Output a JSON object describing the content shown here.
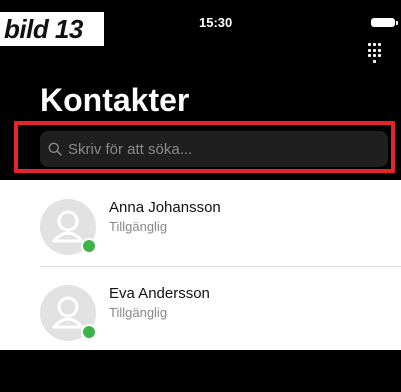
{
  "caption": "bild 13",
  "status_bar": {
    "time": "15:30",
    "battery_icon": "battery-icon"
  },
  "header": {
    "title": "Kontakter",
    "keypad_icon": "keypad-grid-icon"
  },
  "search": {
    "placeholder": "Skriv för att söka...",
    "value": "",
    "icon": "search-icon"
  },
  "contacts": [
    {
      "name": "Anna Johansson",
      "status": "Tillgänglig",
      "avatar_icon": "person-placeholder-icon"
    },
    {
      "name": "Eva Andersson",
      "status": "Tillgänglig",
      "avatar_icon": "person-placeholder-icon"
    }
  ],
  "colors": {
    "highlight": "#e8242b",
    "available": "#3eb34a",
    "header_bg": "#000000"
  }
}
